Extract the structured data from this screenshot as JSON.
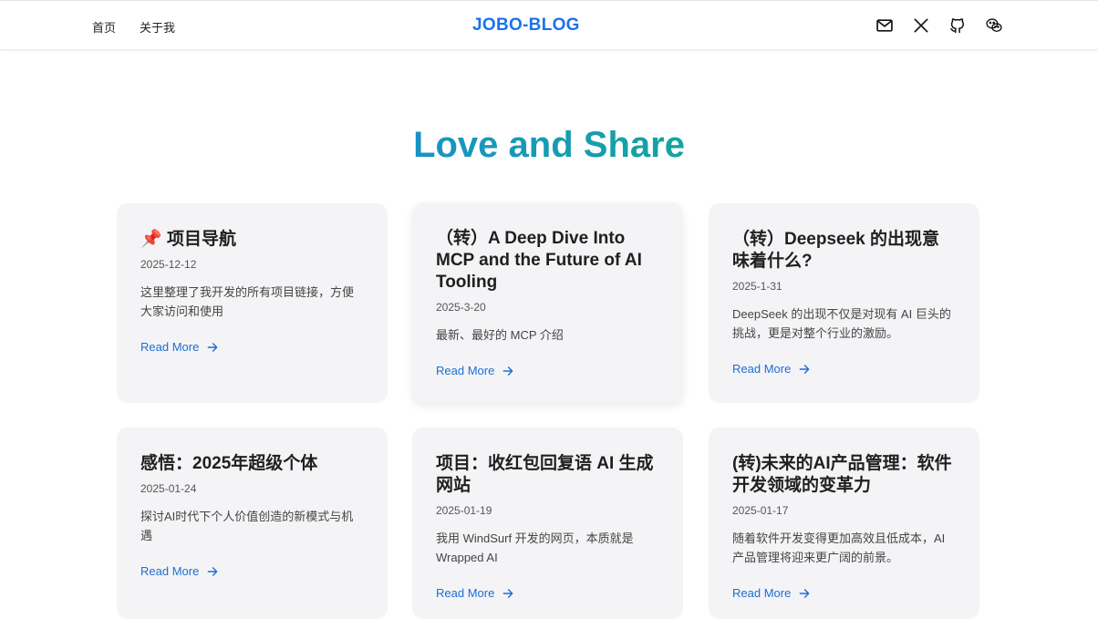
{
  "header": {
    "nav": [
      {
        "label": "首页"
      },
      {
        "label": "关于我"
      }
    ],
    "logo": "JOBO-BLOG",
    "icons": [
      "mail-icon",
      "x-icon",
      "github-icon",
      "wechat-icon"
    ]
  },
  "hero": {
    "title": "Love and Share"
  },
  "colors": {
    "accent": "#1a73e8",
    "link": "#1a6fd6",
    "card_bg": "#f4f4f6",
    "gradient_start": "#1a93c4",
    "gradient_end": "#14a3a0"
  },
  "cards": [
    {
      "emoji": "📌",
      "title": "项目导航",
      "date": "2025-12-12",
      "desc": "这里整理了我开发的所有项目链接，方便大家访问和使用",
      "link": "Read More"
    },
    {
      "title": "（转）A Deep Dive Into MCP and the Future of AI Tooling",
      "date": "2025-3-20",
      "desc": "最新、最好的 MCP 介绍",
      "link": "Read More"
    },
    {
      "title": "（转）Deepseek 的出现意味着什么?",
      "date": "2025-1-31",
      "desc": "DeepSeek 的出现不仅是对现有 AI 巨头的挑战，更是对整个行业的激励。",
      "link": "Read More"
    },
    {
      "title": "感悟：2025年超级个体",
      "date": "2025-01-24",
      "desc": "探讨AI时代下个人价值创造的新模式与机遇",
      "link": "Read More"
    },
    {
      "title": "项目：收红包回复语 AI 生成网站",
      "date": "2025-01-19",
      "desc": "我用 WindSurf 开发的网页，本质就是 Wrapped AI",
      "link": "Read More"
    },
    {
      "title": "(转)未来的AI产品管理：软件开发领域的变革力",
      "date": "2025-01-17",
      "desc": "随着软件开发变得更加高效且低成本，AI 产品管理将迎来更广阔的前景。",
      "link": "Read More"
    }
  ]
}
